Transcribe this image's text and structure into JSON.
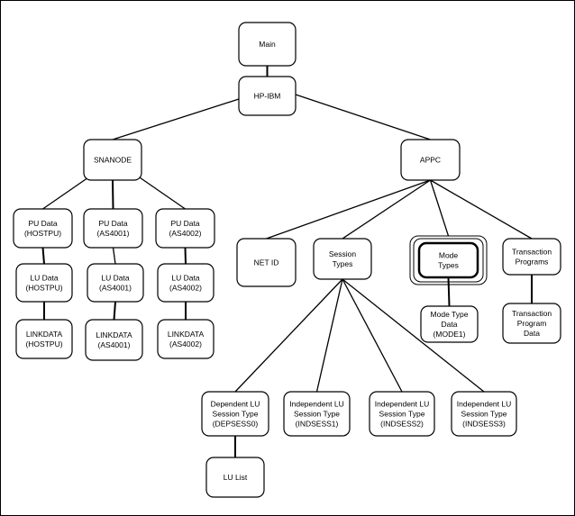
{
  "diagram": {
    "nodes": [
      {
        "id": "main",
        "lines": [
          "Main"
        ]
      },
      {
        "id": "hpibm",
        "lines": [
          "HP-IBM"
        ]
      },
      {
        "id": "snanode",
        "lines": [
          "SNANODE"
        ]
      },
      {
        "id": "appc",
        "lines": [
          "APPC"
        ]
      },
      {
        "id": "pu_host",
        "lines": [
          "PU Data",
          "(HOSTPU)"
        ]
      },
      {
        "id": "pu_as1",
        "lines": [
          "PU Data",
          "(AS4001)"
        ]
      },
      {
        "id": "pu_as2",
        "lines": [
          "PU Data",
          "(AS4002)"
        ]
      },
      {
        "id": "lu_host",
        "lines": [
          "LU Data",
          "(HOSTPU)"
        ]
      },
      {
        "id": "lu_as1",
        "lines": [
          "LU Data",
          "(AS4001)"
        ]
      },
      {
        "id": "lu_as2",
        "lines": [
          "LU Data",
          "(AS4002)"
        ]
      },
      {
        "id": "lk_host",
        "lines": [
          "LINKDATA",
          "(HOSTPU)"
        ]
      },
      {
        "id": "lk_as1",
        "lines": [
          "LINKDATA",
          "(AS4001)"
        ]
      },
      {
        "id": "lk_as2",
        "lines": [
          "LINKDATA",
          "(AS4002)"
        ]
      },
      {
        "id": "netid",
        "lines": [
          "NET ID"
        ]
      },
      {
        "id": "session",
        "lines": [
          "Session",
          "Types"
        ]
      },
      {
        "id": "mode",
        "lines": [
          "Mode",
          "Types"
        ],
        "selected": true
      },
      {
        "id": "tp",
        "lines": [
          "Transaction",
          "Programs"
        ]
      },
      {
        "id": "modedata",
        "lines": [
          "Mode Type",
          "Data",
          "(MODE1)"
        ]
      },
      {
        "id": "tpdata",
        "lines": [
          "Transaction",
          "Program",
          "Data"
        ]
      },
      {
        "id": "dep",
        "lines": [
          "Dependent LU",
          "Session Type",
          "(DEPSESS0)"
        ]
      },
      {
        "id": "ind1",
        "lines": [
          "Independent LU",
          "Session Type",
          "(INDSESS1)"
        ]
      },
      {
        "id": "ind2",
        "lines": [
          "Independent LU",
          "Session Type",
          "(INDSESS2)"
        ]
      },
      {
        "id": "ind3",
        "lines": [
          "Independent LU",
          "Session Type",
          "(INDSESS3)"
        ]
      },
      {
        "id": "lulist",
        "lines": [
          "LU List"
        ]
      }
    ],
    "edges": [
      [
        "main",
        "hpibm"
      ],
      [
        "hpibm",
        "snanode"
      ],
      [
        "hpibm",
        "appc"
      ],
      [
        "snanode",
        "pu_host"
      ],
      [
        "snanode",
        "pu_as1"
      ],
      [
        "snanode",
        "pu_as2"
      ],
      [
        "pu_host",
        "lu_host"
      ],
      [
        "pu_as1",
        "lu_as1"
      ],
      [
        "pu_as2",
        "lu_as2"
      ],
      [
        "lu_host",
        "lk_host"
      ],
      [
        "lu_as1",
        "lk_as1"
      ],
      [
        "lu_as2",
        "lk_as2"
      ],
      [
        "appc",
        "netid"
      ],
      [
        "appc",
        "session"
      ],
      [
        "appc",
        "mode"
      ],
      [
        "appc",
        "tp"
      ],
      [
        "mode",
        "modedata"
      ],
      [
        "tp",
        "tpdata"
      ],
      [
        "session",
        "dep"
      ],
      [
        "session",
        "ind1"
      ],
      [
        "session",
        "ind2"
      ],
      [
        "session",
        "ind3"
      ],
      [
        "dep",
        "lulist"
      ]
    ]
  }
}
